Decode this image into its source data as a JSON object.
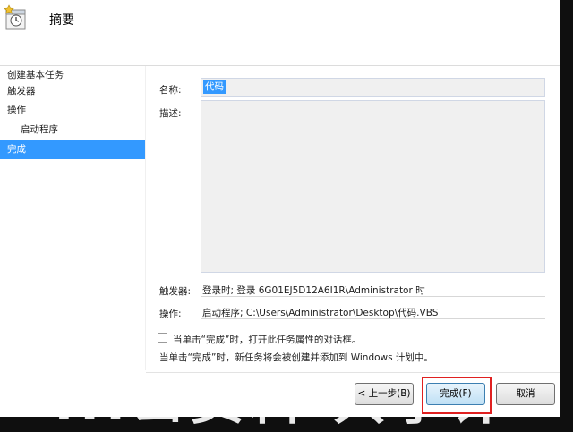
{
  "background_text": "...ㄩ资料 共享计",
  "window": {
    "title": "摘要"
  },
  "sidebar": {
    "items": [
      {
        "label": "创建基本任务"
      },
      {
        "label": "触发器"
      },
      {
        "label": "操作"
      },
      {
        "label": "启动程序"
      },
      {
        "label": "完成"
      }
    ]
  },
  "form": {
    "name_label": "名称:",
    "name_value": "代码",
    "desc_label": "描述:",
    "desc_value": "",
    "trigger_label": "触发器:",
    "trigger_value": "登录时; 登录 6G01EJ5D12A6I1R\\Administrator 时",
    "action_label": "操作:",
    "action_value": "启动程序; C:\\Users\\Administrator\\Desktop\\代码.VBS",
    "checkbox_label": "当单击“完成”时，打开此任务属性的对话框。",
    "checkbox_checked": false,
    "note": "当单击“完成”时，新任务将会被创建并添加到 Windows 计划中。"
  },
  "buttons": {
    "back": "< 上一步(B)",
    "finish": "完成(F)",
    "cancel": "取消"
  },
  "colors": {
    "selection": "#3399ff",
    "highlight": "#e02020"
  }
}
